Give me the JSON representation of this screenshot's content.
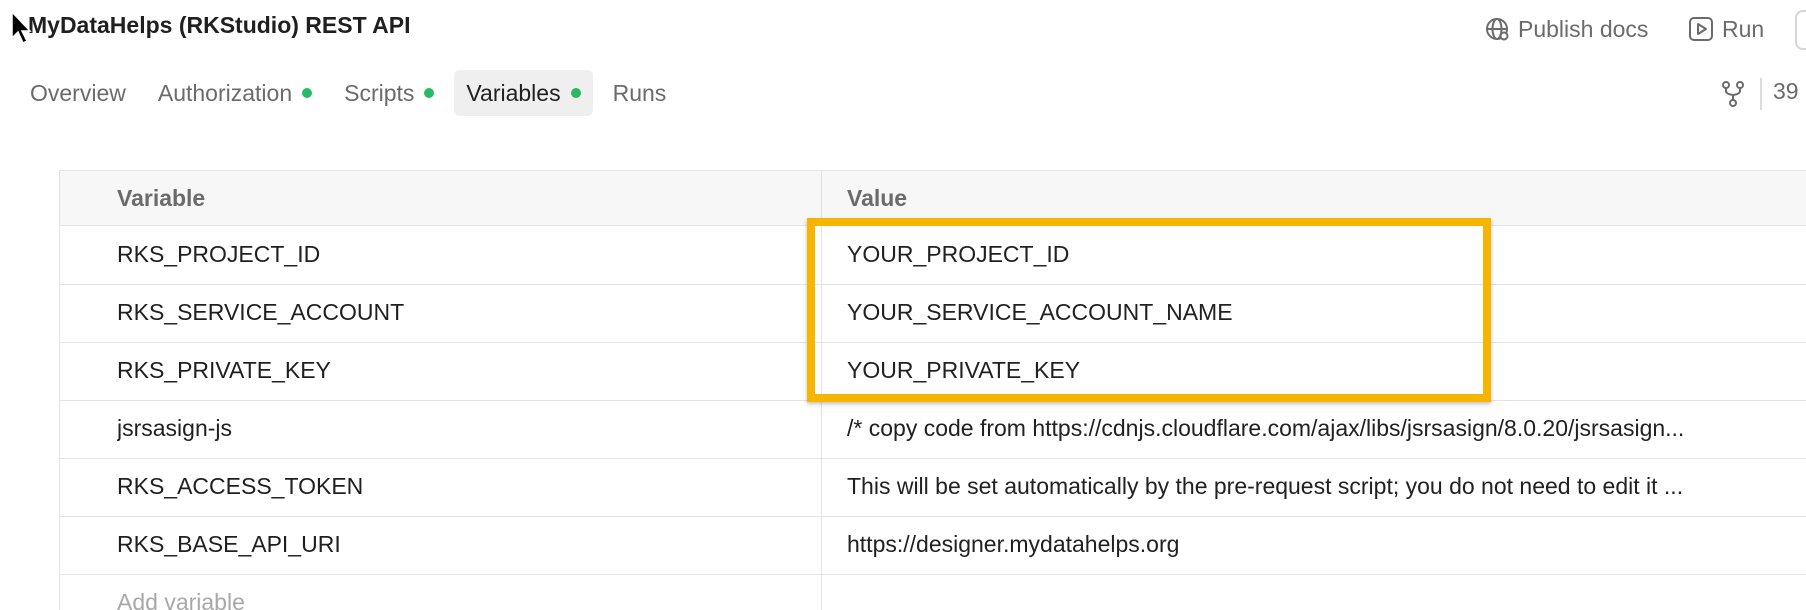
{
  "header": {
    "title": "MyDataHelps (RKStudio) REST API",
    "publish_label": "Publish docs",
    "run_label": "Run"
  },
  "tabs": [
    {
      "label": "Overview",
      "active": false,
      "dot": false
    },
    {
      "label": "Authorization",
      "active": false,
      "dot": true
    },
    {
      "label": "Scripts",
      "active": false,
      "dot": true
    },
    {
      "label": "Variables",
      "active": true,
      "dot": true
    },
    {
      "label": "Runs",
      "active": false,
      "dot": false
    }
  ],
  "toolbar": {
    "count": "39"
  },
  "table": {
    "columns": [
      "Variable",
      "Value"
    ],
    "rows": [
      {
        "name": "RKS_PROJECT_ID",
        "value": "YOUR_PROJECT_ID"
      },
      {
        "name": "RKS_SERVICE_ACCOUNT",
        "value": "YOUR_SERVICE_ACCOUNT_NAME"
      },
      {
        "name": "RKS_PRIVATE_KEY",
        "value": "YOUR_PRIVATE_KEY"
      },
      {
        "name": "jsrsasign-js",
        "value": "/* copy code from https://cdnjs.cloudflare.com/ajax/libs/jsrsasign/8.0.20/jsrsasign..."
      },
      {
        "name": "RKS_ACCESS_TOKEN",
        "value": "This will be set automatically by the pre-request script; you do not need to edit it ..."
      },
      {
        "name": "RKS_BASE_API_URI",
        "value": "https://designer.mydatahelps.org"
      }
    ],
    "add_placeholder": "Add variable"
  },
  "colors": {
    "highlight": "#f6b500",
    "status_dot": "#29b865"
  },
  "icons": {
    "publish": "globe-icon",
    "run": "play-icon",
    "fork": "fork-icon",
    "cursor": "mouse-pointer-icon"
  }
}
